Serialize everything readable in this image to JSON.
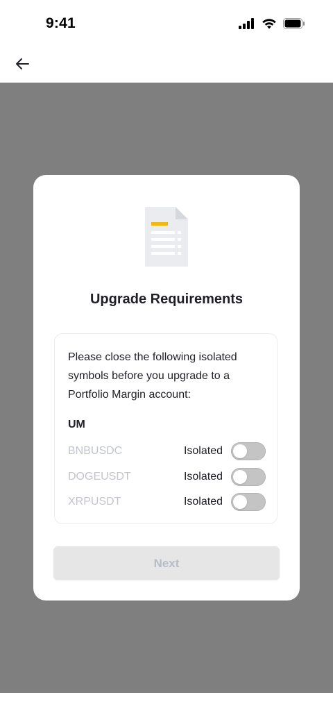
{
  "status_bar": {
    "time": "9:41",
    "icons": [
      "cellular-signal-icon",
      "wifi-icon",
      "battery-icon"
    ]
  },
  "nav": {
    "back_icon": "arrow-left-icon"
  },
  "modal": {
    "illustration_icon": "document-icon",
    "title": "Upgrade Requirements",
    "message": "Please close the following isolated symbols before you upgrade to a Portfolio Margin account:",
    "section_label": "UM",
    "symbols": [
      {
        "name": "BNBUSDC",
        "mode": "Isolated",
        "toggle_on": false
      },
      {
        "name": "DOGEUSDT",
        "mode": "Isolated",
        "toggle_on": false
      },
      {
        "name": "XRPUSDT",
        "mode": "Isolated",
        "toggle_on": false
      }
    ],
    "next_label": "Next",
    "next_enabled": false
  },
  "colors": {
    "overlay": "#7f7f7f",
    "accent_yellow": "#f0b90b",
    "disabled_button_bg": "#e6e6e6",
    "disabled_button_text": "#b7bdc6",
    "symbol_text_muted": "#c2c5cc"
  }
}
